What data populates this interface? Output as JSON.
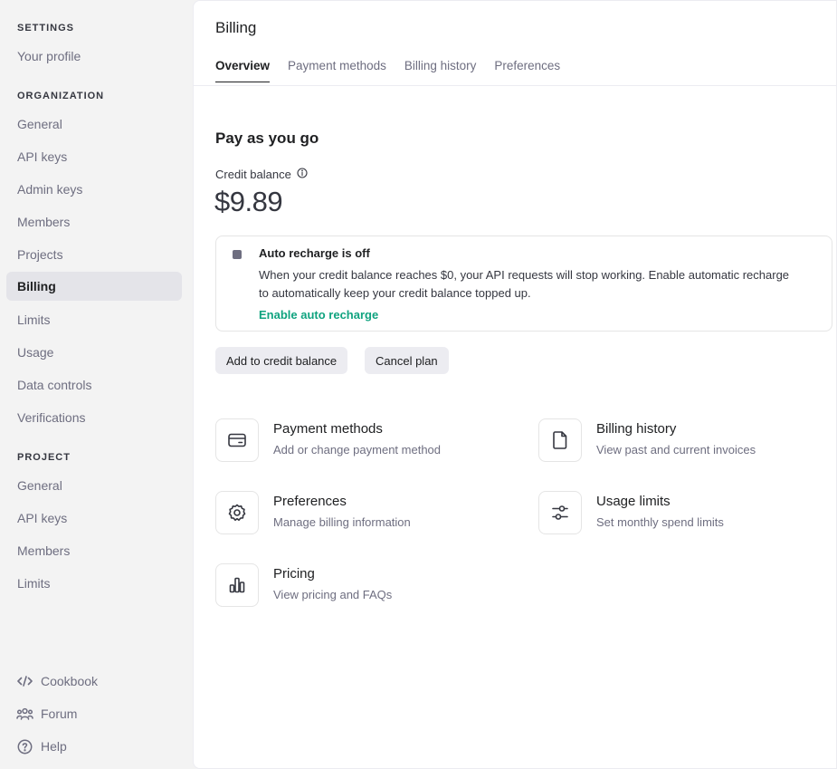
{
  "sidebar": {
    "settings_title": "SETTINGS",
    "profile": "Your profile",
    "organization_title": "ORGANIZATION",
    "org_items": [
      "General",
      "API keys",
      "Admin keys",
      "Members",
      "Projects",
      "Billing",
      "Limits",
      "Usage",
      "Data controls",
      "Verifications"
    ],
    "project_title": "PROJECT",
    "project_items": [
      "General",
      "API keys",
      "Members",
      "Limits"
    ],
    "footer": {
      "cookbook": "Cookbook",
      "forum": "Forum",
      "help": "Help"
    }
  },
  "main": {
    "title": "Billing",
    "tabs": [
      "Overview",
      "Payment methods",
      "Billing history",
      "Preferences"
    ],
    "section_title": "Pay as you go",
    "credit_label": "Credit balance",
    "credit_amount": "$9.89",
    "recharge": {
      "title": "Auto recharge is off",
      "description": "When your credit balance reaches $0, your API requests will stop working. Enable automatic recharge to automatically keep your credit balance topped up.",
      "link": "Enable auto recharge"
    },
    "buttons": {
      "add_credit": "Add to credit balance",
      "cancel_plan": "Cancel plan"
    },
    "cards": {
      "payment_methods": {
        "title": "Payment methods",
        "subtitle": "Add or change payment method"
      },
      "billing_history": {
        "title": "Billing history",
        "subtitle": "View past and current invoices"
      },
      "preferences": {
        "title": "Preferences",
        "subtitle": "Manage billing information"
      },
      "usage_limits": {
        "title": "Usage limits",
        "subtitle": "Set monthly spend limits"
      },
      "pricing": {
        "title": "Pricing",
        "subtitle": "View pricing and FAQs"
      }
    }
  },
  "colors": {
    "accent": "#10a37f",
    "active_bg": "#e4e4e9",
    "sidebar_bg": "#f3f3f3"
  }
}
